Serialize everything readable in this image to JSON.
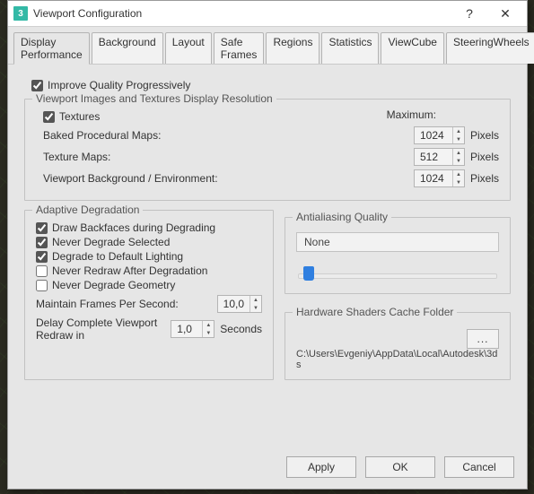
{
  "window": {
    "title": "Viewport Configuration"
  },
  "tabs": {
    "items": [
      "Display Performance",
      "Background",
      "Layout",
      "Safe Frames",
      "Regions",
      "Statistics",
      "ViewCube",
      "SteeringWheels"
    ],
    "active_index": 0
  },
  "improve_quality": {
    "label": "Improve Quality Progressively",
    "checked": true
  },
  "textures_group": {
    "title": "Viewport Images and Textures Display Resolution",
    "textures_checkbox": {
      "label": "Textures",
      "checked": true
    },
    "max_label": "Maximum:",
    "rows": [
      {
        "label": "Baked Procedural Maps:",
        "value": "1024",
        "unit": "Pixels"
      },
      {
        "label": "Texture Maps:",
        "value": "512",
        "unit": "Pixels"
      },
      {
        "label": "Viewport Background / Environment:",
        "value": "1024",
        "unit": "Pixels"
      }
    ]
  },
  "degradation_group": {
    "title": "Adaptive Degradation",
    "checks": [
      {
        "label": "Draw Backfaces during Degrading",
        "checked": true
      },
      {
        "label": "Never Degrade Selected",
        "checked": true
      },
      {
        "label": "Degrade to Default Lighting",
        "checked": true
      },
      {
        "label": "Never Redraw After Degradation",
        "checked": false
      },
      {
        "label": "Never Degrade Geometry",
        "checked": false
      }
    ],
    "fps_label": "Maintain Frames Per Second:",
    "fps_value": "10,0",
    "delay_label_a": "Delay Complete Viewport Redraw in",
    "delay_value": "1,0",
    "delay_unit": "Seconds"
  },
  "aa_group": {
    "title": "Antialiasing Quality",
    "value": "None"
  },
  "cache_group": {
    "title": "Hardware Shaders Cache Folder",
    "browse": "...",
    "path": "C:\\Users\\Evgeniy\\AppData\\Local\\Autodesk\\3ds"
  },
  "buttons": {
    "apply": "Apply",
    "ok": "OK",
    "cancel": "Cancel"
  },
  "icons": {
    "help": "?",
    "close": "✕",
    "app": "3"
  }
}
